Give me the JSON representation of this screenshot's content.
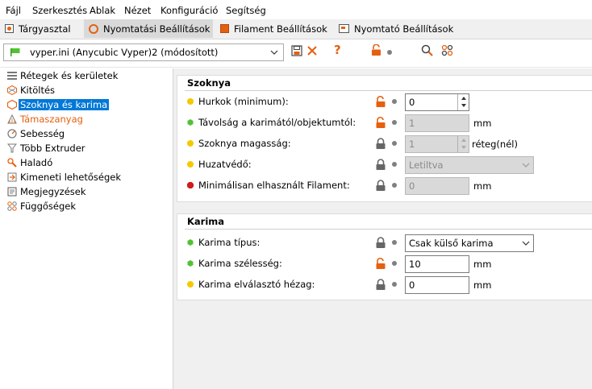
{
  "menubar": {
    "items": [
      "Fájl",
      "Szerkesztés",
      "Ablak",
      "Nézet",
      "Konfiguráció",
      "Segítség"
    ]
  },
  "tabs": [
    {
      "label": "Tárgyasztal",
      "active": false
    },
    {
      "label": "Nyomtatási Beállítások",
      "active": true
    },
    {
      "label": "Filament Beállítások",
      "active": false
    },
    {
      "label": "Nyomtató Beállítások",
      "active": false
    }
  ],
  "toolbar": {
    "preset_value": "vyper.ini (Anycubic Vyper)2 (módosított)",
    "help_glyph": "?"
  },
  "sidebar": {
    "items": [
      {
        "label": "Rétegek és kerületek",
        "icon": "layers-icon"
      },
      {
        "label": "Kitöltés",
        "icon": "infill-icon"
      },
      {
        "label": "Szoknya és karima",
        "icon": "skirt-icon",
        "selected": true
      },
      {
        "label": "Támaszanyag",
        "icon": "support-icon",
        "orange": true
      },
      {
        "label": "Sebesség",
        "icon": "speed-icon"
      },
      {
        "label": "Több Extruder",
        "icon": "extruder-icon"
      },
      {
        "label": "Haladó",
        "icon": "wrench-icon"
      },
      {
        "label": "Kimeneti lehetőségek",
        "icon": "output-icon"
      },
      {
        "label": "Megjegyzések",
        "icon": "notes-icon"
      },
      {
        "label": "Függőségek",
        "icon": "dependencies-icon"
      }
    ]
  },
  "skirt": {
    "title": "Szoknya",
    "rows": [
      {
        "label": "Hurkok (minimum):",
        "value": "0",
        "unit": "",
        "status": "yellow",
        "lock": "open",
        "type": "spin"
      },
      {
        "label": "Távolság a karimától/objektumtól:",
        "value": "1",
        "unit": "mm",
        "status": "green",
        "lock": "open",
        "type": "disabled"
      },
      {
        "label": "Szoknya magasság:",
        "value": "1",
        "unit": "réteg(nél)",
        "status": "yellow",
        "lock": "closed",
        "type": "disabled-spin"
      },
      {
        "label": "Huzatvédő:",
        "value": "Letiltva",
        "unit": "",
        "status": "yellow",
        "lock": "closed",
        "type": "disabled-select"
      },
      {
        "label": "Minimálisan elhasznált Filament:",
        "value": "0",
        "unit": "mm",
        "status": "red",
        "lock": "closed",
        "type": "disabled"
      }
    ]
  },
  "brim": {
    "title": "Karima",
    "rows": [
      {
        "label": "Karima típus:",
        "value": "Csak külső karima",
        "unit": "",
        "status": "green",
        "lock": "closed",
        "type": "select"
      },
      {
        "label": "Karima szélesség:",
        "value": "10",
        "unit": "mm",
        "status": "green",
        "lock": "open",
        "type": "text"
      },
      {
        "label": "Karima elválasztó hézag:",
        "value": "0",
        "unit": "mm",
        "status": "yellow",
        "lock": "closed",
        "type": "text"
      }
    ]
  },
  "colors": {
    "accent_orange": "#e5600f",
    "selection_blue": "#0078d7",
    "status_yellow": "#f6c800",
    "status_green": "#52c234",
    "status_red": "#d11c1c"
  }
}
